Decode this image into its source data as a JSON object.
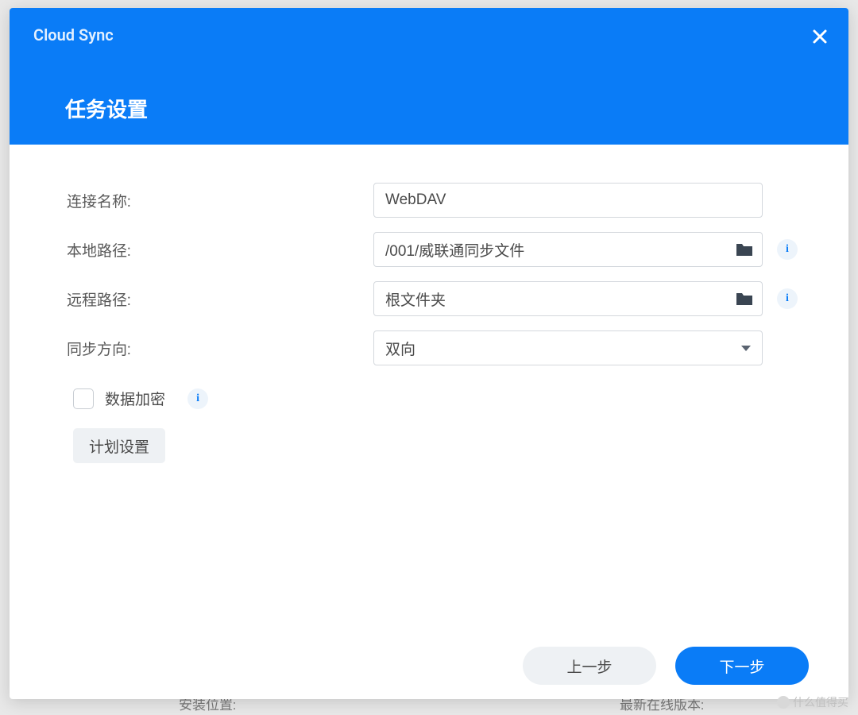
{
  "app": {
    "title": "Cloud Sync",
    "page_title": "任务设置"
  },
  "form": {
    "connection_name": {
      "label": "连接名称:",
      "value": "WebDAV"
    },
    "local_path": {
      "label": "本地路径:",
      "value": "/001/威联通同步文件"
    },
    "remote_path": {
      "label": "远程路径:",
      "value": "根文件夹"
    },
    "sync_direction": {
      "label": "同步方向:",
      "value": "双向"
    },
    "data_encryption": {
      "label": "数据加密"
    },
    "schedule_button": "计划设置"
  },
  "footer": {
    "prev": "上一步",
    "next": "下一步"
  },
  "background": {
    "text1": "安装位置:",
    "text2": "最新在线版本:"
  },
  "watermark": "什么值得买"
}
